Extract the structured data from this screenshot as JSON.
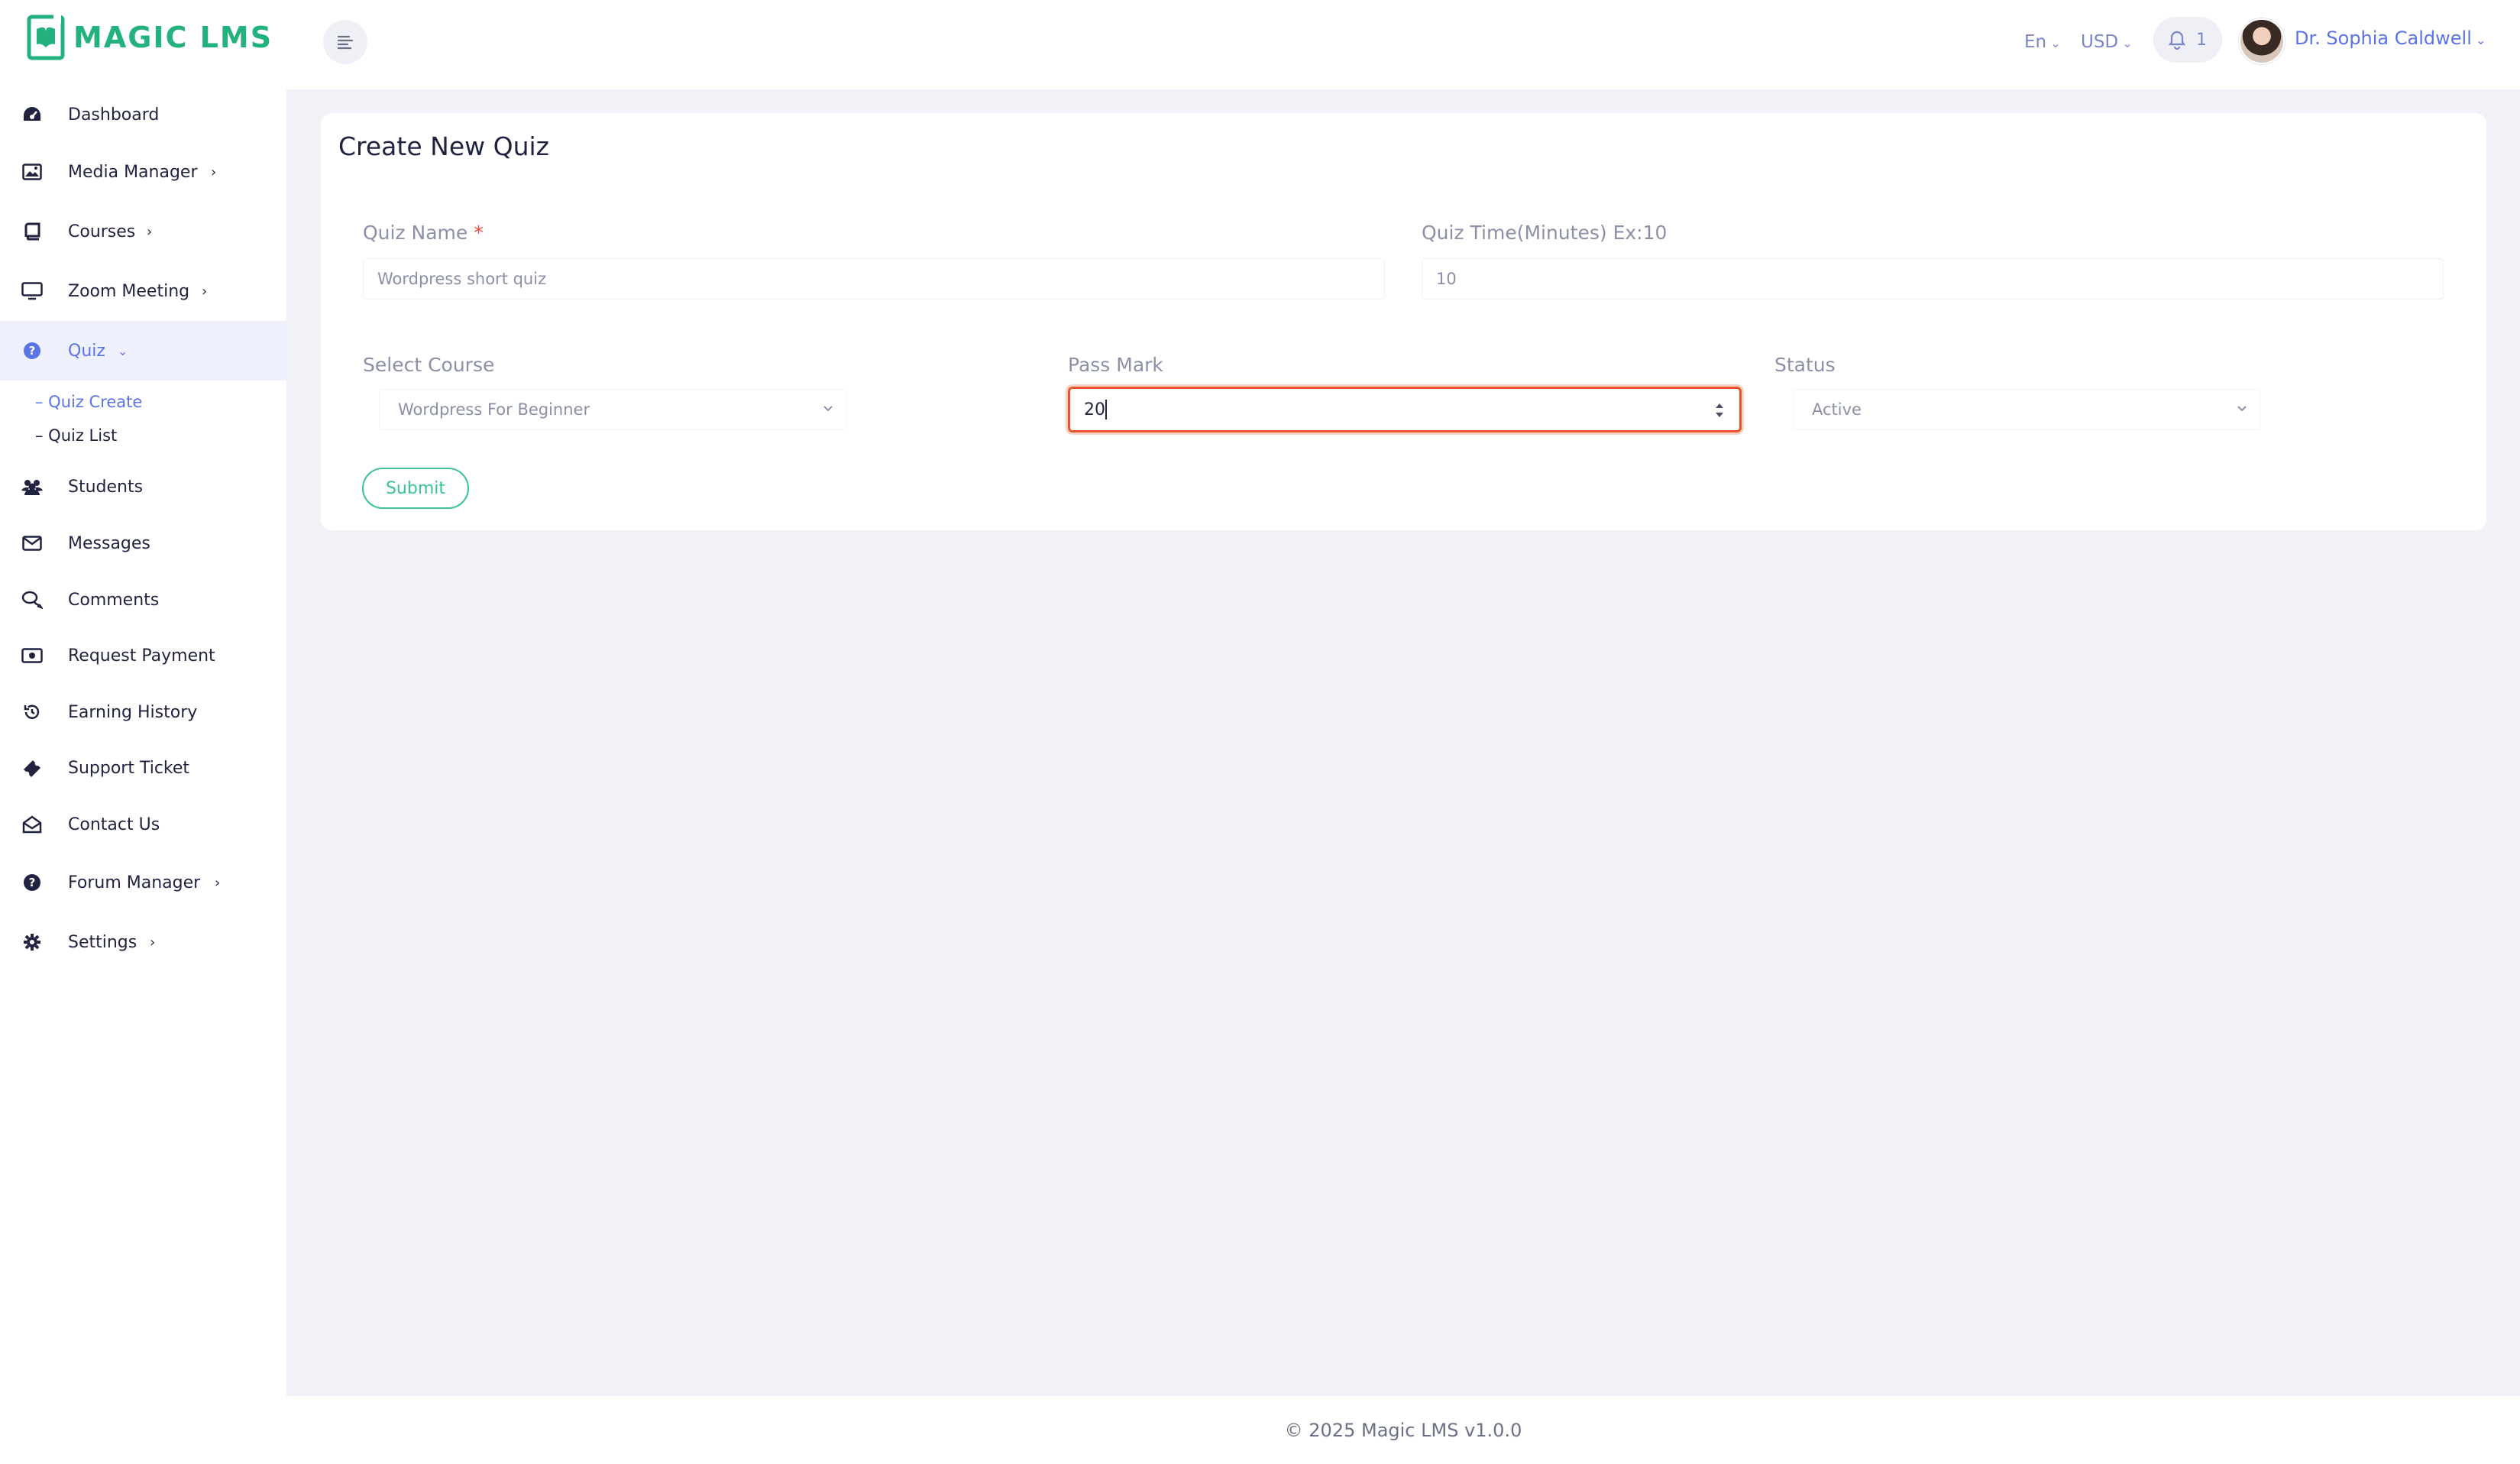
{
  "brand": {
    "name": "MAGIC LMS",
    "color": "#23b27e"
  },
  "header": {
    "language": "En",
    "currency": "USD",
    "notification_count": "1",
    "user_name": "Dr. Sophia Caldwell"
  },
  "sidebar": {
    "items": [
      {
        "label": "Dashboard",
        "icon": "dashboard-icon"
      },
      {
        "label": "Media Manager",
        "icon": "image-icon"
      },
      {
        "label": "Courses",
        "icon": "book-icon"
      },
      {
        "label": "Zoom Meeting",
        "icon": "monitor-icon"
      },
      {
        "label": "Quiz",
        "icon": "question-icon"
      },
      {
        "label": "Students",
        "icon": "users-icon"
      },
      {
        "label": "Messages",
        "icon": "mail-icon"
      },
      {
        "label": "Comments",
        "icon": "comments-icon"
      },
      {
        "label": "Request Payment",
        "icon": "money-icon"
      },
      {
        "label": "Earning History",
        "icon": "history-icon"
      },
      {
        "label": "Support Ticket",
        "icon": "ticket-icon"
      },
      {
        "label": "Contact Us",
        "icon": "envelope-open-icon"
      },
      {
        "label": "Forum Manager",
        "icon": "question-icon"
      },
      {
        "label": "Settings",
        "icon": "gear-icon"
      }
    ],
    "quiz_sub": [
      "– Quiz Create",
      "– Quiz List"
    ]
  },
  "form": {
    "title": "Create New Quiz",
    "quiz_name_label": "Quiz Name",
    "required_mark": "*",
    "quiz_name_value": "Wordpress short quiz",
    "quiz_time_label": "Quiz Time(Minutes) Ex:10",
    "quiz_time_value": "10",
    "course_label": "Select Course",
    "course_value": "Wordpress For Beginner",
    "pass_mark_label": "Pass Mark",
    "pass_mark_value": "20",
    "status_label": "Status",
    "status_value": "Active",
    "submit_label": "Submit"
  },
  "footer": {
    "text": "© 2025 Magic LMS v1.0.0"
  }
}
